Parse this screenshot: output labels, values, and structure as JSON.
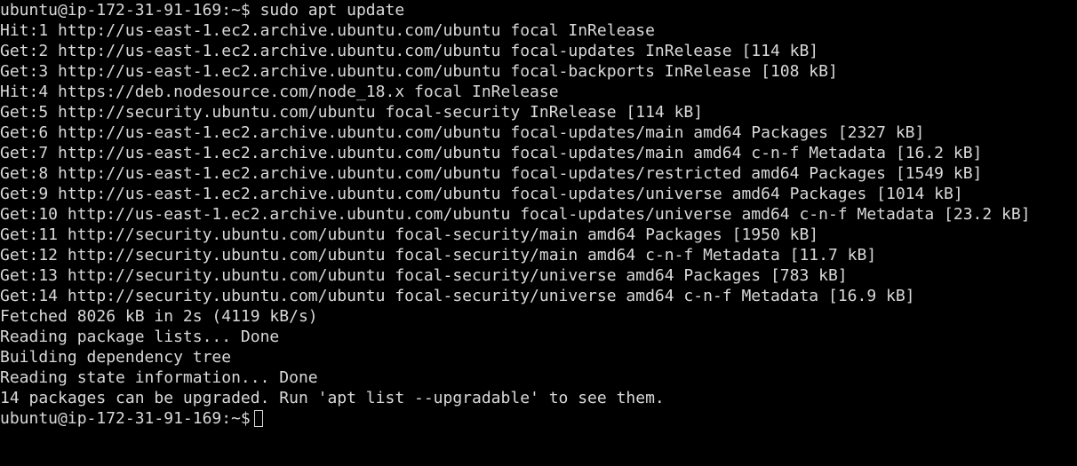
{
  "terminal": {
    "colors": {
      "background": "#000000",
      "foreground": "#d9d9d9"
    },
    "lines": [
      "ubuntu@ip-172-31-91-169:~$ sudo apt update",
      "Hit:1 http://us-east-1.ec2.archive.ubuntu.com/ubuntu focal InRelease",
      "Get:2 http://us-east-1.ec2.archive.ubuntu.com/ubuntu focal-updates InRelease [114 kB]",
      "Get:3 http://us-east-1.ec2.archive.ubuntu.com/ubuntu focal-backports InRelease [108 kB]",
      "Hit:4 https://deb.nodesource.com/node_18.x focal InRelease",
      "Get:5 http://security.ubuntu.com/ubuntu focal-security InRelease [114 kB]",
      "Get:6 http://us-east-1.ec2.archive.ubuntu.com/ubuntu focal-updates/main amd64 Packages [2327 kB]",
      "Get:7 http://us-east-1.ec2.archive.ubuntu.com/ubuntu focal-updates/main amd64 c-n-f Metadata [16.2 kB]",
      "Get:8 http://us-east-1.ec2.archive.ubuntu.com/ubuntu focal-updates/restricted amd64 Packages [1549 kB]",
      "Get:9 http://us-east-1.ec2.archive.ubuntu.com/ubuntu focal-updates/universe amd64 Packages [1014 kB]",
      "Get:10 http://us-east-1.ec2.archive.ubuntu.com/ubuntu focal-updates/universe amd64 c-n-f Metadata [23.2 kB]",
      "Get:11 http://security.ubuntu.com/ubuntu focal-security/main amd64 Packages [1950 kB]",
      "Get:12 http://security.ubuntu.com/ubuntu focal-security/main amd64 c-n-f Metadata [11.7 kB]",
      "Get:13 http://security.ubuntu.com/ubuntu focal-security/universe amd64 Packages [783 kB]",
      "Get:14 http://security.ubuntu.com/ubuntu focal-security/universe amd64 c-n-f Metadata [16.9 kB]",
      "Fetched 8026 kB in 2s (4119 kB/s)",
      "Reading package lists... Done",
      "Building dependency tree",
      "Reading state information... Done",
      "14 packages can be upgraded. Run 'apt list --upgradable' to see them."
    ],
    "prompt": "ubuntu@ip-172-31-91-169:~$"
  }
}
